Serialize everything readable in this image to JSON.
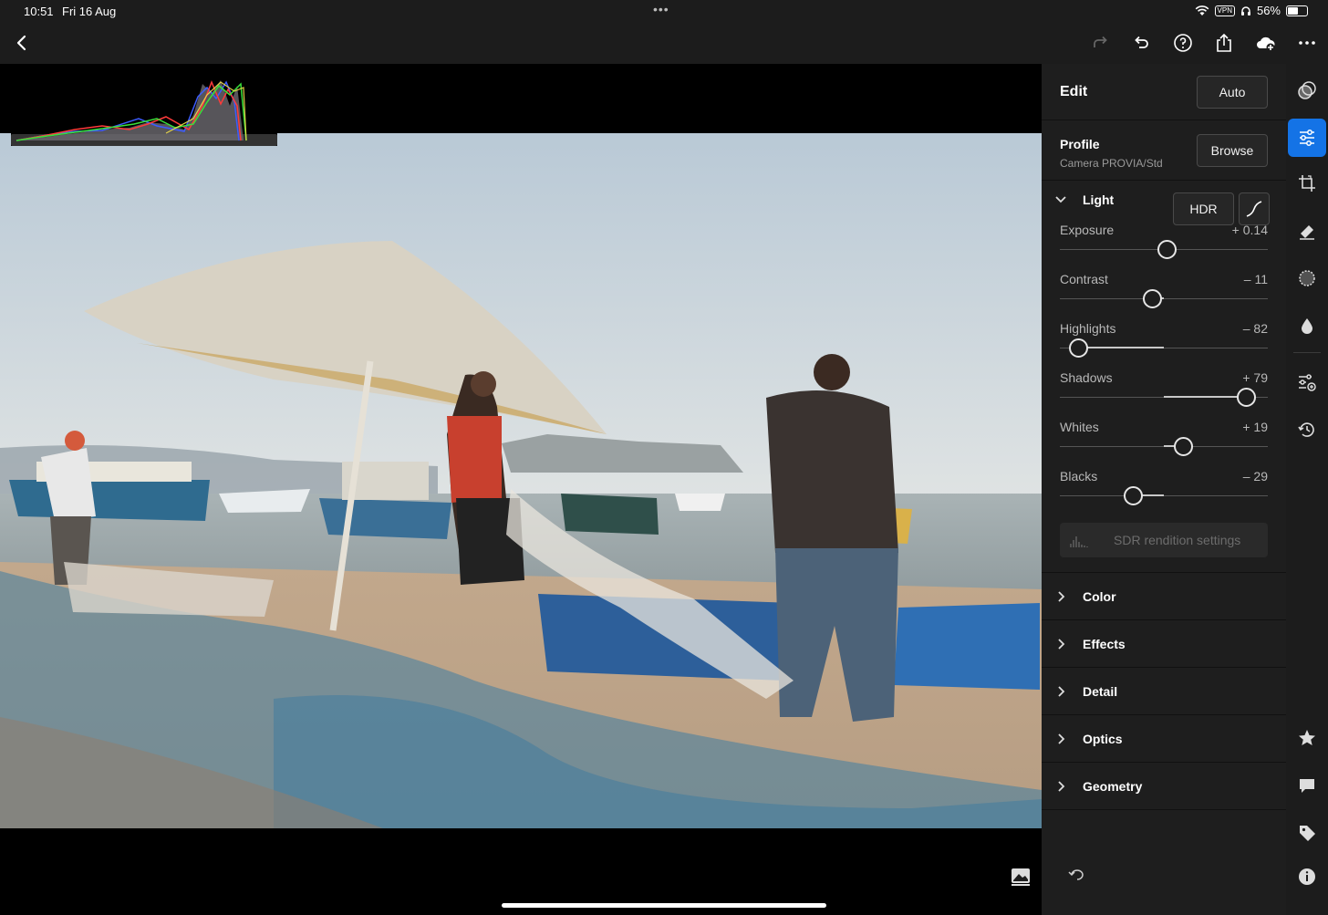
{
  "status_bar": {
    "time": "10:51",
    "date": "Fri 16 Aug",
    "multitask_dots": "•••",
    "vpn": "VPN",
    "battery": "56%",
    "battery_level": 0.56
  },
  "toolbar": {
    "back": "back-icon",
    "redo": "redo-icon",
    "undo": "undo-icon",
    "help": "help-icon",
    "share": "share-icon",
    "cloud": "cloud-add-icon",
    "more": "more-icon"
  },
  "edit_panel": {
    "title": "Edit",
    "auto_label": "Auto",
    "profile": {
      "label": "Profile",
      "value": "Camera PROVIA/Std",
      "browse_label": "Browse"
    },
    "light": {
      "title": "Light",
      "hdr_label": "HDR",
      "sliders": [
        {
          "label": "Exposure",
          "value": "+ 0.14",
          "level": 0.514
        },
        {
          "label": "Contrast",
          "value": "– 11",
          "level": 0.445
        },
        {
          "label": "Highlights",
          "value": "– 82",
          "level": 0.09
        },
        {
          "label": "Shadows",
          "value": "+ 79",
          "level": 0.895
        },
        {
          "label": "Whites",
          "value": "+ 19",
          "level": 0.595
        },
        {
          "label": "Blacks",
          "value": "– 29",
          "level": 0.355
        }
      ],
      "sdr_label": "SDR rendition settings"
    },
    "sections": [
      {
        "title": "Color"
      },
      {
        "title": "Effects"
      },
      {
        "title": "Detail"
      },
      {
        "title": "Optics"
      },
      {
        "title": "Geometry"
      }
    ]
  },
  "colors": {
    "accent": "#1473e6",
    "panel_bg": "#1e1e1e",
    "toolbar_bg": "#1c1c1c"
  }
}
